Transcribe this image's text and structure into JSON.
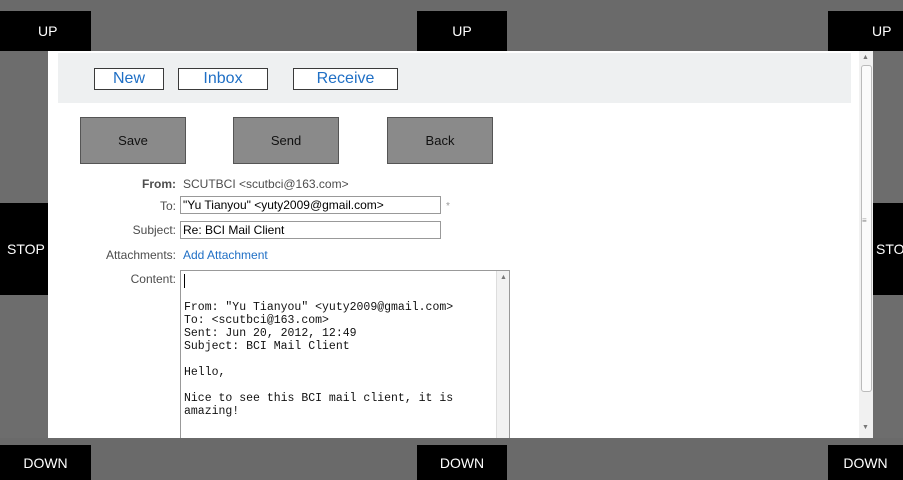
{
  "edges": {
    "up": "UP",
    "stop": "STOP",
    "stop_right": "STO",
    "down": "DOWN"
  },
  "nav": {
    "new": "New",
    "inbox": "Inbox",
    "receive": "Receive"
  },
  "toolbar": {
    "save": "Save",
    "send": "Send",
    "back": "Back"
  },
  "form": {
    "from_label": "From:",
    "from_value": "SCUTBCI <scutbci@163.com>",
    "to_label": "To:",
    "to_value": "\"Yu Tianyou\" <yuty2009@gmail.com>",
    "required_mark": "*",
    "subject_label": "Subject:",
    "subject_value": "Re: BCI Mail Client",
    "attachments_label": "Attachments:",
    "add_attachment": "Add Attachment",
    "content_label": "Content:",
    "content_value": "\n\nFrom: \"Yu Tianyou\" <yuty2009@gmail.com>\nTo: <scutbci@163.com>\nSent: Jun 20, 2012, 12:49\nSubject: BCI Mail Client\n\nHello,\n\nNice to see this BCI mail client, it is\namazing!"
  },
  "icons": {
    "scroll_up": "▲",
    "scroll_down": "▼",
    "scroll_grip": "≡"
  },
  "colors": {
    "link": "#1f6fc5",
    "edge": "#000000",
    "button": "#8a8a8a"
  }
}
